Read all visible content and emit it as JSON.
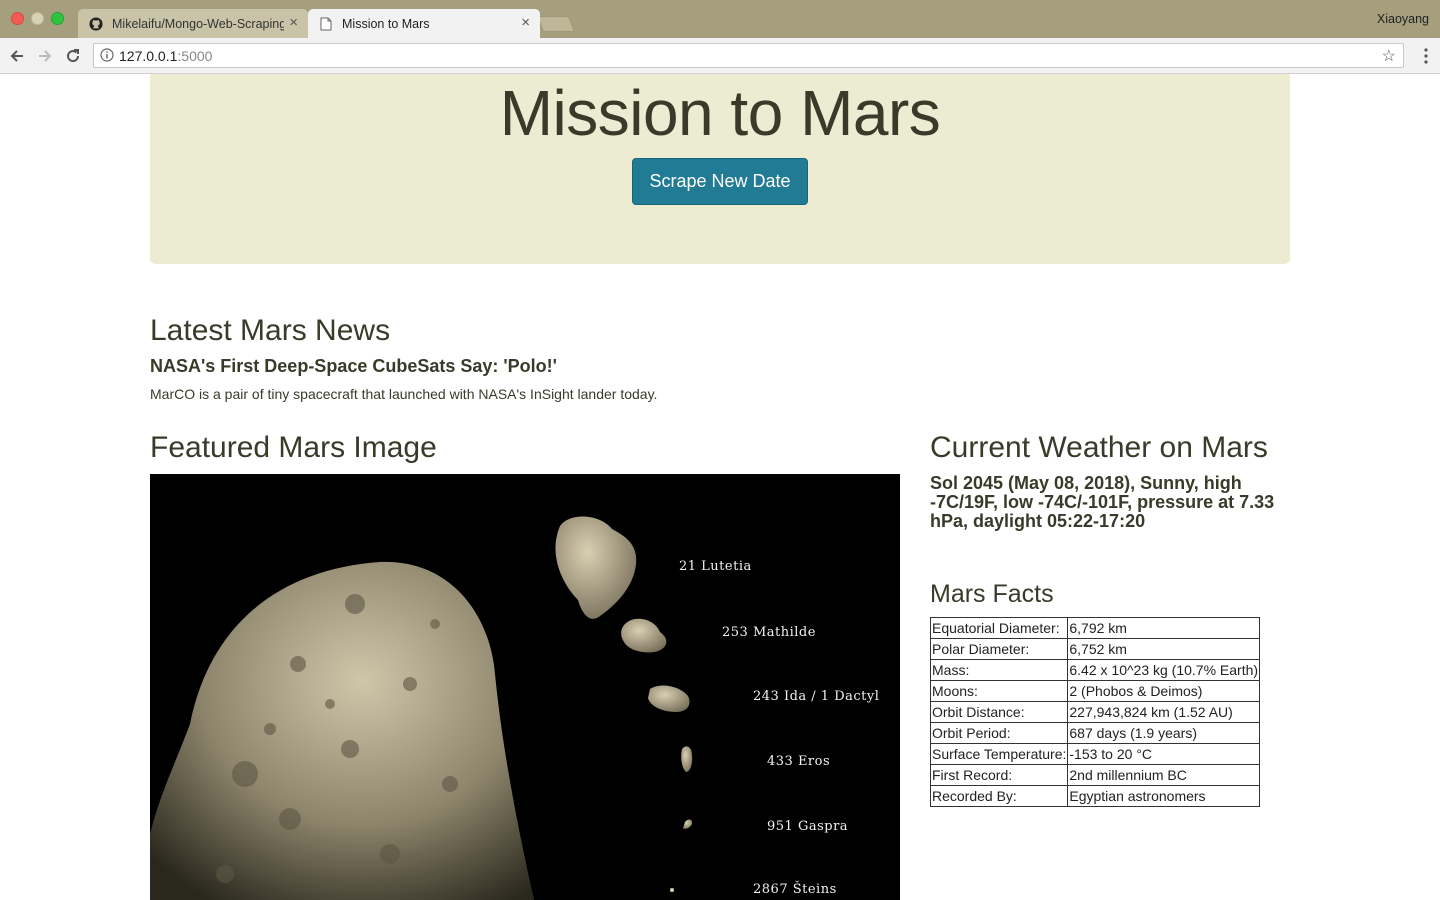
{
  "browser": {
    "tabs": [
      {
        "title": "Mikelaifu/Mongo-Web-Scraping",
        "active": false
      },
      {
        "title": "Mission to Mars",
        "active": true
      }
    ],
    "profile_name": "Xiaoyang",
    "url_host": "127.0.0.1",
    "url_port": ":5000"
  },
  "header": {
    "title": "Mission to Mars",
    "scrape_button": "Scrape New Date"
  },
  "news": {
    "section_title": "Latest Mars News",
    "headline": "NASA's First Deep-Space CubeSats Say: 'Polo!'",
    "teaser": "MarCO is a pair of tiny spacecraft that launched with NASA's InSight lander today."
  },
  "featured": {
    "section_title": "Featured Mars Image",
    "labels": [
      "21 Lutetia",
      "253 Mathilde",
      "243 Ida / 1 Dactyl",
      "433 Eros",
      "951 Gaspra",
      "2867 Šteins"
    ]
  },
  "weather": {
    "section_title": "Current Weather on Mars",
    "text": "Sol 2045 (May 08, 2018), Sunny, high -7C/19F, low -74C/-101F, pressure at 7.33 hPa, daylight 05:22-17:20"
  },
  "facts": {
    "section_title": "Mars Facts",
    "rows": [
      {
        "key": "Equatorial Diameter:",
        "value": "6,792 km"
      },
      {
        "key": "Polar Diameter:",
        "value": "6,752 km"
      },
      {
        "key": "Mass:",
        "value": "6.42 x 10^23 kg (10.7% Earth)"
      },
      {
        "key": "Moons:",
        "value": "2 (Phobos & Deimos)"
      },
      {
        "key": "Orbit Distance:",
        "value": "227,943,824 km (1.52 AU)"
      },
      {
        "key": "Orbit Period:",
        "value": "687 days (1.9 years)"
      },
      {
        "key": "Surface Temperature:",
        "value": "-153 to 20 °C"
      },
      {
        "key": "First Record:",
        "value": "2nd millennium BC"
      },
      {
        "key": "Recorded By:",
        "value": "Egyptian astronomers"
      }
    ]
  }
}
